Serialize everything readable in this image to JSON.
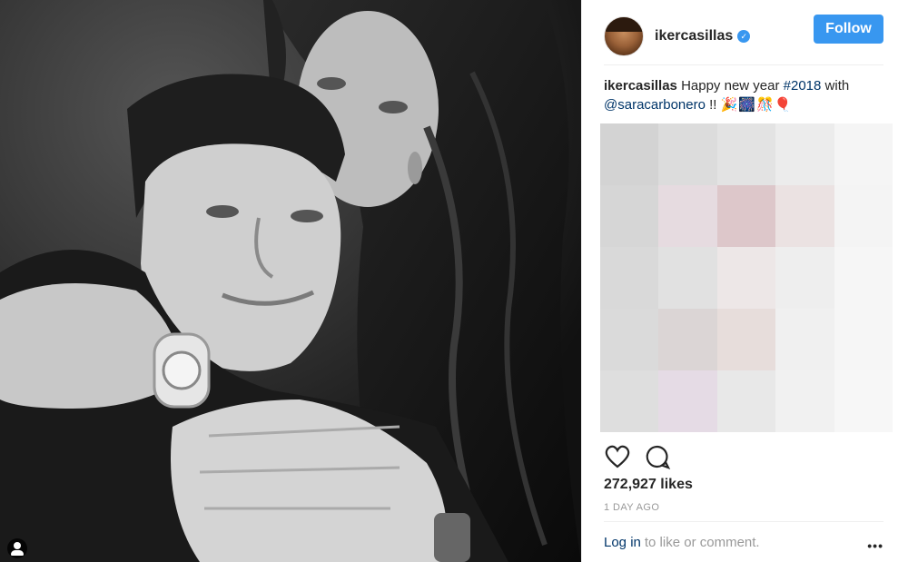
{
  "post": {
    "username": "ikercasillas",
    "follow_label": "Follow",
    "caption_username": "ikercasillas",
    "caption_text_1": " Happy new year ",
    "caption_hashtag": "#2018",
    "caption_text_2": " with",
    "caption_mention": "@saracarbonero",
    "caption_tail": " !! ",
    "caption_emojis": "🎉🎆🎊🎈",
    "likes": "272,927 likes",
    "time": "1 DAY AGO",
    "login_link": "Log in",
    "login_rest": "to like or comment.",
    "more_label": "•••"
  },
  "colors": {
    "accent": "#3897f0",
    "link": "#003569",
    "muted": "#999999"
  },
  "icons": {
    "like": "heart-outline-icon",
    "comment": "speech-bubble-icon",
    "verified": "verified-badge-icon",
    "more": "ellipsis-icon",
    "tag": "user-tag-icon"
  }
}
